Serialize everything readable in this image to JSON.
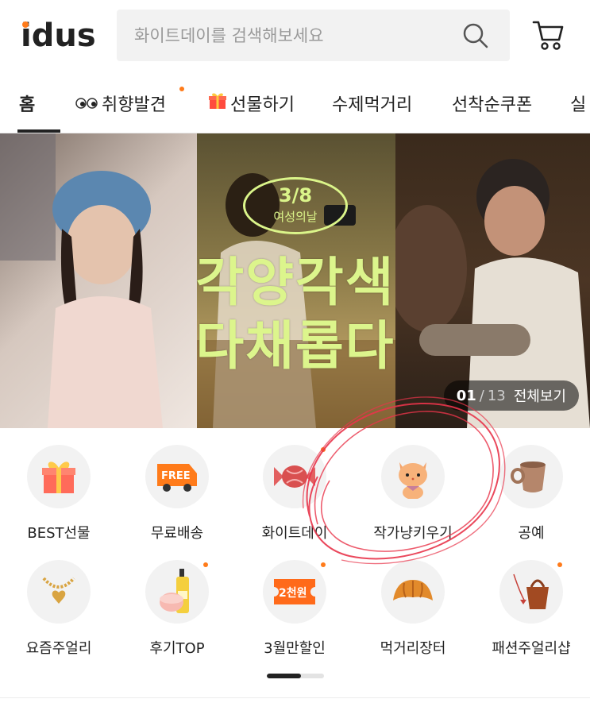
{
  "header": {
    "logo_text": "idus",
    "search_placeholder": "화이트데이를 검색해보세요",
    "brand_color": "#ff7b1a"
  },
  "nav": {
    "tabs": [
      {
        "label": "홈",
        "icon": "",
        "active": true,
        "dot": false
      },
      {
        "label": "취향발견",
        "icon": "eyes-icon",
        "active": false,
        "dot": true
      },
      {
        "label": "선물하기",
        "icon": "gift-icon",
        "active": false,
        "dot": false
      },
      {
        "label": "수제먹거리",
        "icon": "",
        "active": false,
        "dot": false
      },
      {
        "label": "선착순쿠폰",
        "icon": "",
        "active": false,
        "dot": false
      },
      {
        "label": "실",
        "icon": "",
        "active": false,
        "dot": false
      }
    ]
  },
  "banner": {
    "badge_big": "3/8",
    "badge_small": "여성의날",
    "title_line1": "각양각색",
    "title_line2": "다채롭다",
    "counter_current": "01",
    "counter_sep": "/",
    "counter_total": "13",
    "counter_link": "전체보기",
    "accent_color": "#dcf58c"
  },
  "categories": [
    {
      "label": "BEST선물",
      "icon": "gift-box-icon",
      "dot": false
    },
    {
      "label": "무료배송",
      "icon": "free-truck-icon",
      "badge_text": "FREE",
      "dot": false
    },
    {
      "label": "화이트데이",
      "icon": "candy-icon",
      "dot": true
    },
    {
      "label": "작가냥키우기",
      "icon": "cat-icon",
      "dot": false
    },
    {
      "label": "공예",
      "icon": "pottery-cup-icon",
      "dot": false
    },
    {
      "label": "요즘주얼리",
      "icon": "necklace-icon",
      "dot": false
    },
    {
      "label": "후기TOP",
      "icon": "cosmetics-icon",
      "dot": true
    },
    {
      "label": "3월만할인",
      "icon": "coupon-icon",
      "badge_text": "2천원",
      "dot": true
    },
    {
      "label": "먹거리장터",
      "icon": "croissant-icon",
      "dot": false
    },
    {
      "label": "패션주얼리샵",
      "icon": "handbag-icon",
      "dot": true
    }
  ],
  "pager": {
    "progress": 0.6
  }
}
